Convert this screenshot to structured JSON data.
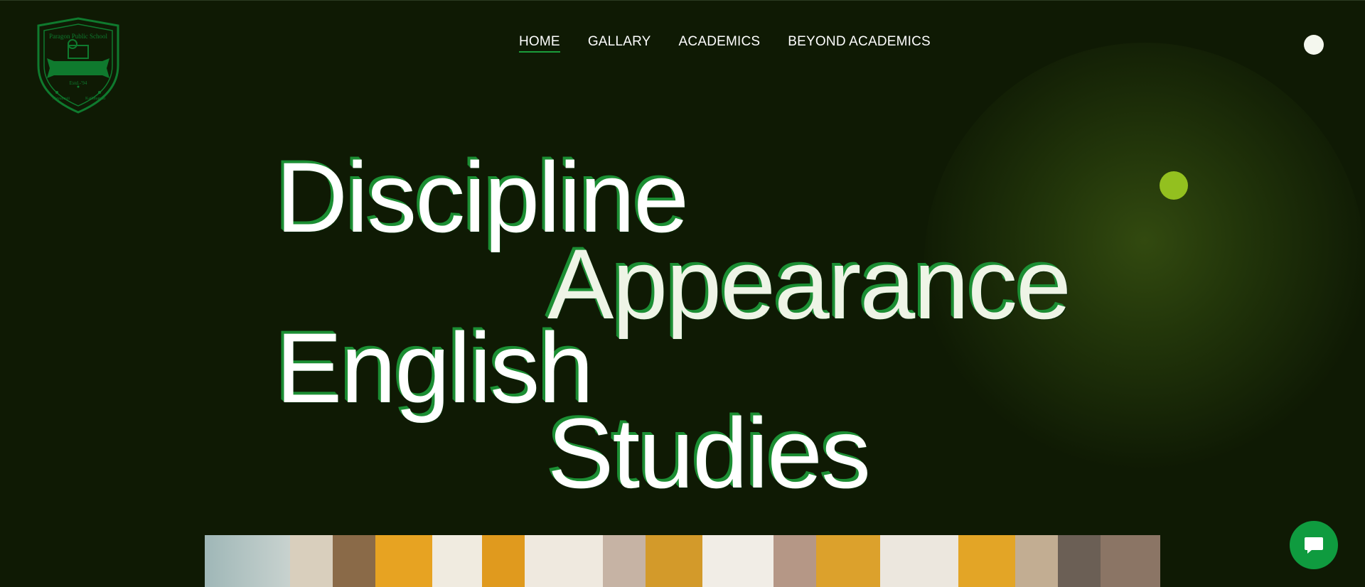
{
  "logo": {
    "school_name": "Paragon Public School",
    "established": "Estd.-'94",
    "location_left": "Nayabasti",
    "location_right": "Kathmandu",
    "color": "#0f7a2e"
  },
  "nav": {
    "items": [
      {
        "label": "HOME",
        "active": true
      },
      {
        "label": "GALLARY",
        "active": false
      },
      {
        "label": "ACADEMICS",
        "active": false
      },
      {
        "label": "BEYOND ACADEMICS",
        "active": false
      }
    ]
  },
  "hero": {
    "words": [
      "Discipline",
      "Appearance",
      "English",
      "Studies"
    ]
  },
  "icons": {
    "menu": "circle-menu-icon",
    "chat": "chat-bubble-icon",
    "decor": "lime-dot-icon"
  },
  "colors": {
    "background": "#0f1a04",
    "accent_green": "#1b8e33",
    "lime": "#93c01f",
    "chat_button": "#0f9b3f"
  }
}
